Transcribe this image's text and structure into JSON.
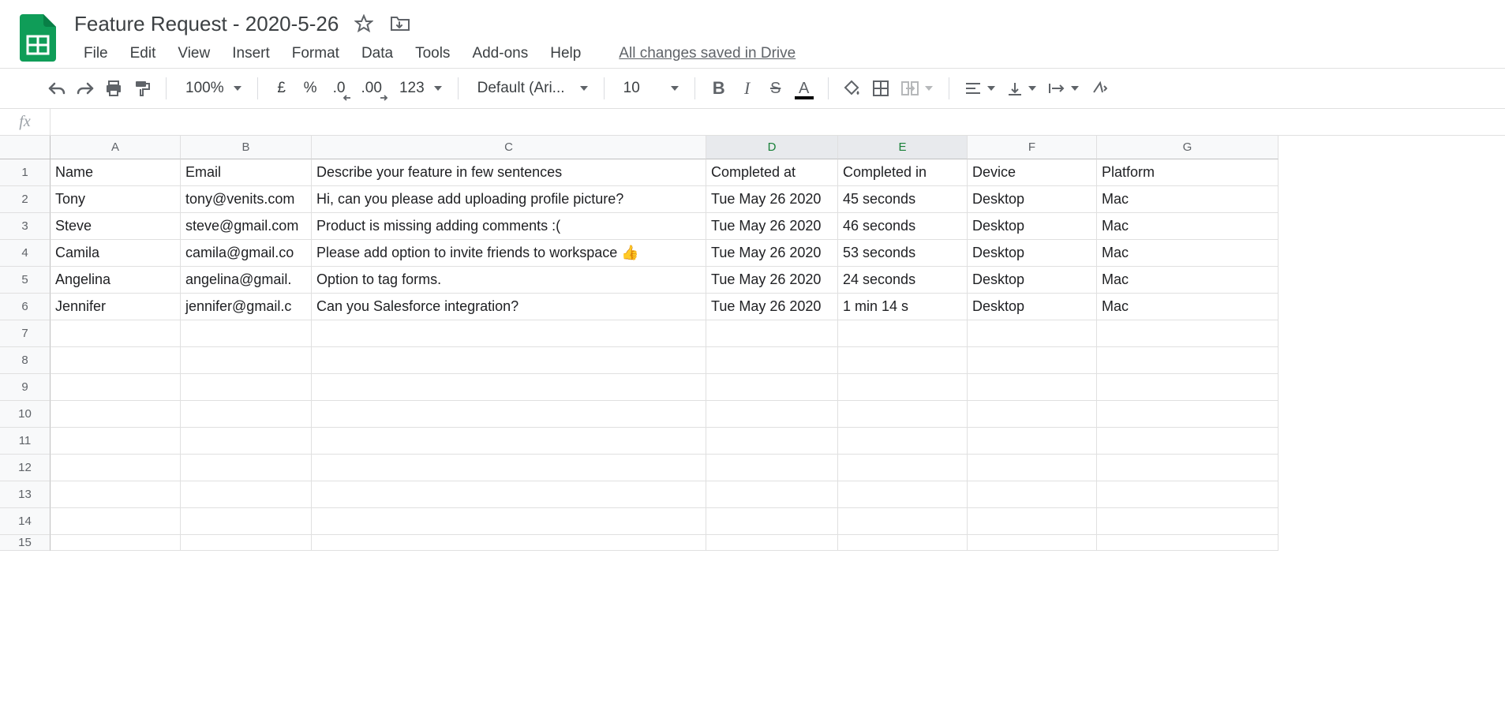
{
  "header": {
    "doc_title": "Feature Request - 2020-5-26",
    "save_status": "All changes saved in Drive"
  },
  "menus": [
    "File",
    "Edit",
    "View",
    "Insert",
    "Format",
    "Data",
    "Tools",
    "Add-ons",
    "Help"
  ],
  "toolbar": {
    "zoom": "100%",
    "currency": "£",
    "percent": "%",
    "dec_dec": ".0",
    "inc_dec": ".00",
    "more_formats": "123",
    "font_name": "Default (Ari...",
    "font_size": "10"
  },
  "formula": {
    "label": "fx",
    "value": ""
  },
  "columns": [
    "A",
    "B",
    "C",
    "D",
    "E",
    "F",
    "G"
  ],
  "selected_columns": [
    "D",
    "E"
  ],
  "row_numbers": [
    "1",
    "2",
    "3",
    "4",
    "5",
    "6",
    "7",
    "8",
    "9",
    "10",
    "11",
    "12",
    "13",
    "14",
    "15"
  ],
  "sheet": {
    "headers": [
      "Name",
      "Email",
      "Describe your feature in few sentences",
      "Completed at",
      "Completed in",
      "Device",
      "Platform"
    ],
    "rows": [
      {
        "name": "Tony",
        "email": "tony@venits.com",
        "desc": "Hi, can you please add uploading profile picture?",
        "completed_at": "Tue May 26 2020",
        "completed_in": "45 seconds",
        "device": "Desktop",
        "platform": "Mac"
      },
      {
        "name": "Steve",
        "email": "steve@gmail.com",
        "desc": "Product is missing adding comments :(",
        "completed_at": "Tue May 26 2020",
        "completed_in": "46 seconds",
        "device": "Desktop",
        "platform": "Mac"
      },
      {
        "name": "Camila",
        "email": "camila@gmail.co",
        "desc": "Please add option to invite friends to workspace 👍",
        "completed_at": "Tue May 26 2020",
        "completed_in": "53 seconds",
        "device": "Desktop",
        "platform": "Mac"
      },
      {
        "name": "Angelina",
        "email": "angelina@gmail.",
        "desc": "Option to tag forms.",
        "completed_at": "Tue May 26 2020",
        "completed_in": "24 seconds",
        "device": "Desktop",
        "platform": "Mac"
      },
      {
        "name": "Jennifer",
        "email": "jennifer@gmail.c",
        "desc": "Can you Salesforce integration?",
        "completed_at": "Tue May 26 2020",
        "completed_in": "1 min 14 s",
        "device": "Desktop",
        "platform": "Mac"
      }
    ]
  }
}
